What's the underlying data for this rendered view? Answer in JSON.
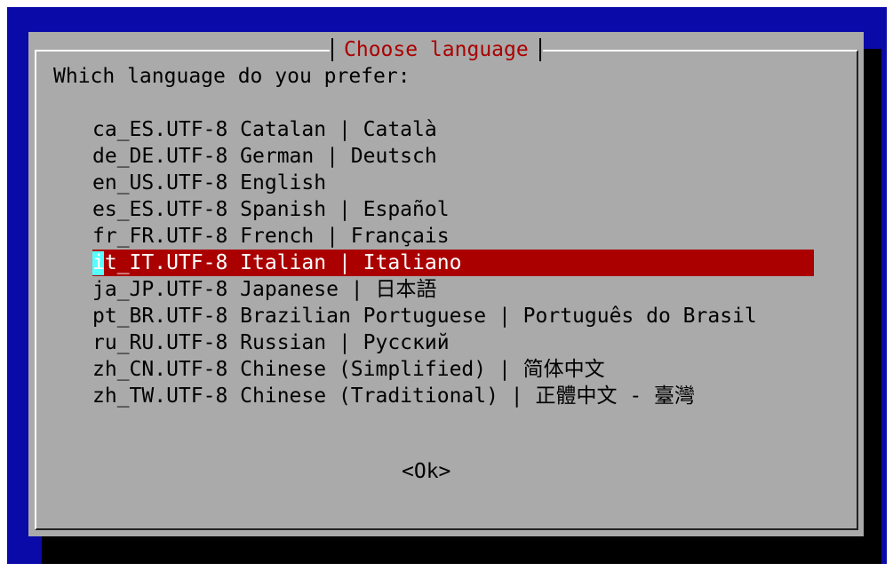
{
  "dialog": {
    "title": "Choose language",
    "prompt": "Which language do you prefer:",
    "items": [
      {
        "label": "ca_ES.UTF-8 Catalan | Català"
      },
      {
        "label": "de_DE.UTF-8 German | Deutsch"
      },
      {
        "label": "en_US.UTF-8 English"
      },
      {
        "label": "es_ES.UTF-8 Spanish | Español"
      },
      {
        "label": "fr_FR.UTF-8 French | Français"
      },
      {
        "label": "it_IT.UTF-8 Italian | Italiano"
      },
      {
        "label": "ja_JP.UTF-8 Japanese | 日本語"
      },
      {
        "label": "pt_BR.UTF-8 Brazilian Portuguese | Português do Brasil"
      },
      {
        "label": "ru_RU.UTF-8 Russian | Русский"
      },
      {
        "label": "zh_CN.UTF-8 Chinese (Simplified) | 简体中文"
      },
      {
        "label": "zh_TW.UTF-8 Chinese (Traditional) | 正體中文 - 臺灣"
      }
    ],
    "selected_index": 5,
    "ok_label": "<Ok>"
  },
  "colors": {
    "screen_background": "#0a0aa8",
    "dialog_background": "#aaaaaa",
    "title_text": "#aa0000",
    "highlight_background": "#aa0000",
    "highlight_text": "#ffffff",
    "cursor": "#55ffff"
  }
}
